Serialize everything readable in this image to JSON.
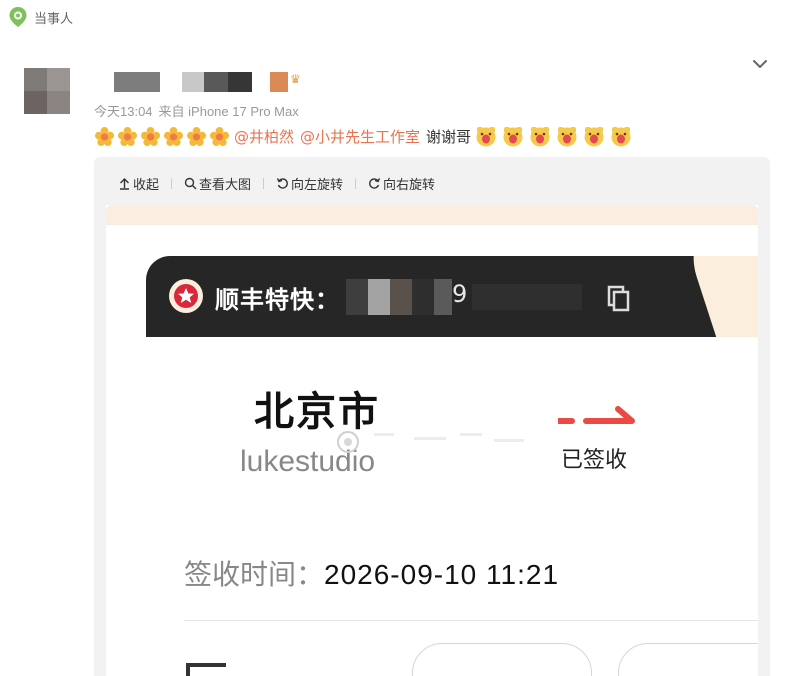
{
  "source": {
    "label": "当事人",
    "icon": "location-pin-icon"
  },
  "post": {
    "meta": {
      "time": "今天13:04",
      "device": "来自 iPhone 17 Pro Max"
    },
    "mentions": [
      "@井柏然",
      "@小井先生工作室"
    ],
    "text": "谢谢哥",
    "emoji_flower_count": 6,
    "emoji_face_count": 6
  },
  "image_toolbar": {
    "collapse": "收起",
    "view_large": "查看大图",
    "rotate_left": "向左旋转",
    "rotate_right": "向右旋转"
  },
  "parcel": {
    "carrier": "顺丰特快：",
    "tracking_visible_tail": "9",
    "destination": "北京市",
    "recipient": "lukestudio",
    "status": "已签收",
    "sign_label": "签收时间：",
    "sign_time": "2026-09-10 11:21"
  },
  "colors": {
    "mention": "#eb7350",
    "sf_header": "#262626",
    "sf_red": "#d8283a",
    "arrow_red": "#e94a43",
    "accent_green": "#7ec35a"
  }
}
